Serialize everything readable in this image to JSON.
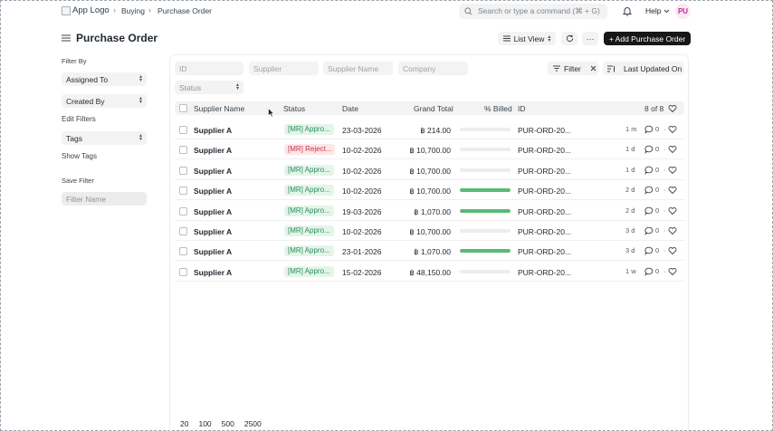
{
  "nav": {
    "logo_alt": "App Logo",
    "breadcrumbs": [
      "Buying",
      "Purchase Order"
    ],
    "search_placeholder": "Search or type a command (⌘ + G)",
    "help_label": "Help",
    "avatar_initials": "PU"
  },
  "header": {
    "title": "Purchase Order",
    "view_label": "List View",
    "more_label": "···",
    "add_label": "+ Add Purchase Order"
  },
  "sidebar": {
    "filter_by_label": "Filter By",
    "assigned_to": "Assigned To",
    "created_by": "Created By",
    "edit_filters": "Edit Filters",
    "tags": "Tags",
    "show_tags": "Show Tags",
    "save_filter_label": "Save Filter",
    "filter_name_placeholder": "Filter Name"
  },
  "filters": {
    "id_placeholder": "ID",
    "supplier_placeholder": "Supplier",
    "supplier_name_placeholder": "Supplier Name",
    "company_placeholder": "Company",
    "status_placeholder": "Status",
    "filter_label": "Filter",
    "sort_label": "Last Updated On"
  },
  "table": {
    "columns": {
      "supplier_name": "Supplier Name",
      "status": "Status",
      "date": "Date",
      "grand_total": "Grand Total",
      "billed": "% Billed",
      "id": "ID"
    },
    "count_label": "8 of 8",
    "rows": [
      {
        "supplier": "Supplier A",
        "status": "[MR] Appro...",
        "status_color": "green",
        "date": "23-03-2026",
        "total": "฿ 214.00",
        "billed": 0,
        "id": "PUR-ORD-20...",
        "age": "1 m",
        "comments": "0"
      },
      {
        "supplier": "Supplier A",
        "status": "[MR] Reject...",
        "status_color": "red",
        "date": "10-02-2026",
        "total": "฿ 10,700.00",
        "billed": 0,
        "id": "PUR-ORD-20...",
        "age": "1 d",
        "comments": "0"
      },
      {
        "supplier": "Supplier A",
        "status": "[MR] Appro...",
        "status_color": "green",
        "date": "10-02-2026",
        "total": "฿ 10,700.00",
        "billed": 0,
        "id": "PUR-ORD-20...",
        "age": "1 d",
        "comments": "0"
      },
      {
        "supplier": "Supplier A",
        "status": "[MR] Appro...",
        "status_color": "green",
        "date": "10-02-2026",
        "total": "฿ 10,700.00",
        "billed": 100,
        "id": "PUR-ORD-20...",
        "age": "2 d",
        "comments": "0"
      },
      {
        "supplier": "Supplier A",
        "status": "[MR] Appro...",
        "status_color": "green",
        "date": "19-03-2026",
        "total": "฿ 1,070.00",
        "billed": 100,
        "id": "PUR-ORD-20...",
        "age": "2 d",
        "comments": "0"
      },
      {
        "supplier": "Supplier A",
        "status": "[MR] Appro...",
        "status_color": "green",
        "date": "10-02-2026",
        "total": "฿ 10,700.00",
        "billed": 0,
        "id": "PUR-ORD-20...",
        "age": "3 d",
        "comments": "0"
      },
      {
        "supplier": "Supplier A",
        "status": "[MR] Appro...",
        "status_color": "green",
        "date": "23-01-2026",
        "total": "฿ 1,070.00",
        "billed": 100,
        "id": "PUR-ORD-20...",
        "age": "3 d",
        "comments": "0"
      },
      {
        "supplier": "Supplier A",
        "status": "[MR] Appro...",
        "status_color": "green",
        "date": "15-02-2026",
        "total": "฿ 48,150.00",
        "billed": 0,
        "id": "PUR-ORD-20...",
        "age": "1 w",
        "comments": "0"
      }
    ]
  },
  "paging": [
    "20",
    "100",
    "500",
    "2500"
  ],
  "colors": {
    "primary": "#171717",
    "success": "#59ba74",
    "danger": "#c4314b",
    "avatar": "#c02b94"
  }
}
